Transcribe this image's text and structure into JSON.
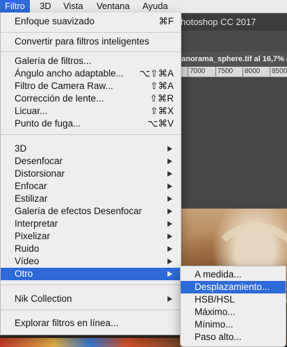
{
  "menubar": {
    "items": [
      {
        "label": "Filtro",
        "active": true
      },
      {
        "label": "3D",
        "active": false
      },
      {
        "label": "Vista",
        "active": false
      },
      {
        "label": "Ventana",
        "active": false
      },
      {
        "label": "Ayuda",
        "active": false
      }
    ]
  },
  "app": {
    "title": "hotoshop CC 2017",
    "document_tab": "anorama_sphere.tif al 16,7% (",
    "ruler_ticks": [
      "7000",
      "7500",
      "8000",
      "8500"
    ]
  },
  "filter_menu": {
    "group1": [
      {
        "label": "Enfoque suavizado",
        "shortcut": "⌘F"
      }
    ],
    "group2": [
      {
        "label": "Convertir para filtros inteligentes"
      }
    ],
    "group3": [
      {
        "label": "Galería de filtros..."
      },
      {
        "label": "Ángulo ancho adaptable...",
        "shortcut": "⌥⇧⌘A"
      },
      {
        "label": "Filtro de Camera Raw...",
        "shortcut": "⇧⌘A"
      },
      {
        "label": "Corrección de lente...",
        "shortcut": "⇧⌘R"
      },
      {
        "label": "Licuar...",
        "shortcut": "⇧⌘X"
      },
      {
        "label": "Punto de fuga...",
        "shortcut": "⌥⌘V"
      }
    ],
    "group4": [
      {
        "label": "3D"
      },
      {
        "label": "Desenfocar"
      },
      {
        "label": "Distorsionar"
      },
      {
        "label": "Enfocar"
      },
      {
        "label": "Estilizar"
      },
      {
        "label": "Galería de efectos Desenfocar"
      },
      {
        "label": "Interpretar"
      },
      {
        "label": "Pixelizar"
      },
      {
        "label": "Ruido"
      },
      {
        "label": "Vídeo"
      },
      {
        "label": "Otro",
        "highlighted": true
      }
    ],
    "group5": [
      {
        "label": "Nik Collection"
      }
    ],
    "group6": [
      {
        "label": "Explorar filtros en línea..."
      }
    ]
  },
  "otro_submenu": {
    "items": [
      {
        "label": "A medida..."
      },
      {
        "label": "Desplazamiento...",
        "highlighted": true
      },
      {
        "label": "HSB/HSL"
      },
      {
        "label": "Máximo..."
      },
      {
        "label": "Mínimo..."
      },
      {
        "label": "Paso alto..."
      }
    ]
  },
  "colors": {
    "highlight": "#2f6bd8",
    "menu_bg": "#eeeeee"
  }
}
